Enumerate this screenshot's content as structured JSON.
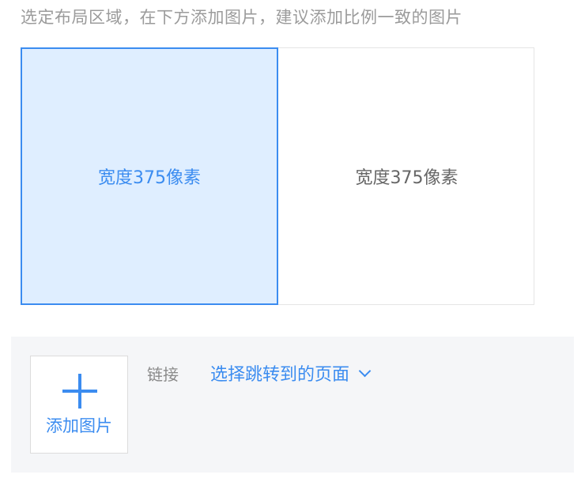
{
  "hint": "选定布局区域，在下方添加图片，建议添加比例一致的图片",
  "layout": {
    "cells": [
      {
        "label": "宽度375像素",
        "selected": true
      },
      {
        "label": "宽度375像素",
        "selected": false
      }
    ]
  },
  "editor": {
    "add_image_label": "添加图片",
    "add_image_icon": "plus-icon",
    "link_label": "链接",
    "link_select_text": "选择跳转到的页面",
    "link_select_icon": "chevron-down-icon"
  },
  "colors": {
    "accent": "#3b8cf0",
    "selected_bg": "#dfeeff",
    "panel_bg": "#f5f6f8",
    "hint_text": "#9b9b9b"
  }
}
